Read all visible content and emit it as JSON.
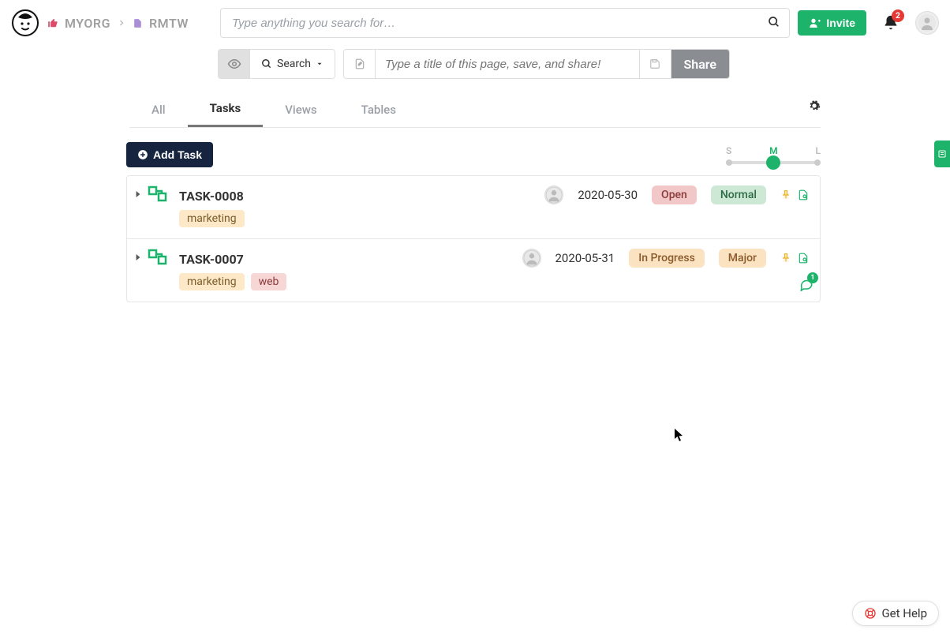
{
  "breadcrumb": {
    "org": "MYORG",
    "project": "RMTW"
  },
  "search": {
    "placeholder": "Type anything you search for…"
  },
  "header": {
    "invite_label": "Invite",
    "notification_count": "2"
  },
  "toolbar": {
    "search_dd_label": "Search",
    "title_placeholder": "Type a title of this page, save, and share!",
    "share_label": "Share"
  },
  "tabs": {
    "all": "All",
    "tasks": "Tasks",
    "views": "Views",
    "tables": "Tables"
  },
  "controls": {
    "add_task_label": "Add Task",
    "size_s": "S",
    "size_m": "M",
    "size_l": "L"
  },
  "tasks": [
    {
      "title": "TASK-0008",
      "date": "2020-05-30",
      "status": "Open",
      "priority": "Normal",
      "tags": [
        "marketing"
      ],
      "status_style": "red",
      "priority_style": "green",
      "comments": null
    },
    {
      "title": "TASK-0007",
      "date": "2020-05-31",
      "status": "In Progress",
      "priority": "Major",
      "tags": [
        "marketing",
        "web"
      ],
      "status_style": "orange",
      "priority_style": "orange",
      "comments": "1"
    }
  ],
  "help": {
    "label": "Get Help"
  }
}
